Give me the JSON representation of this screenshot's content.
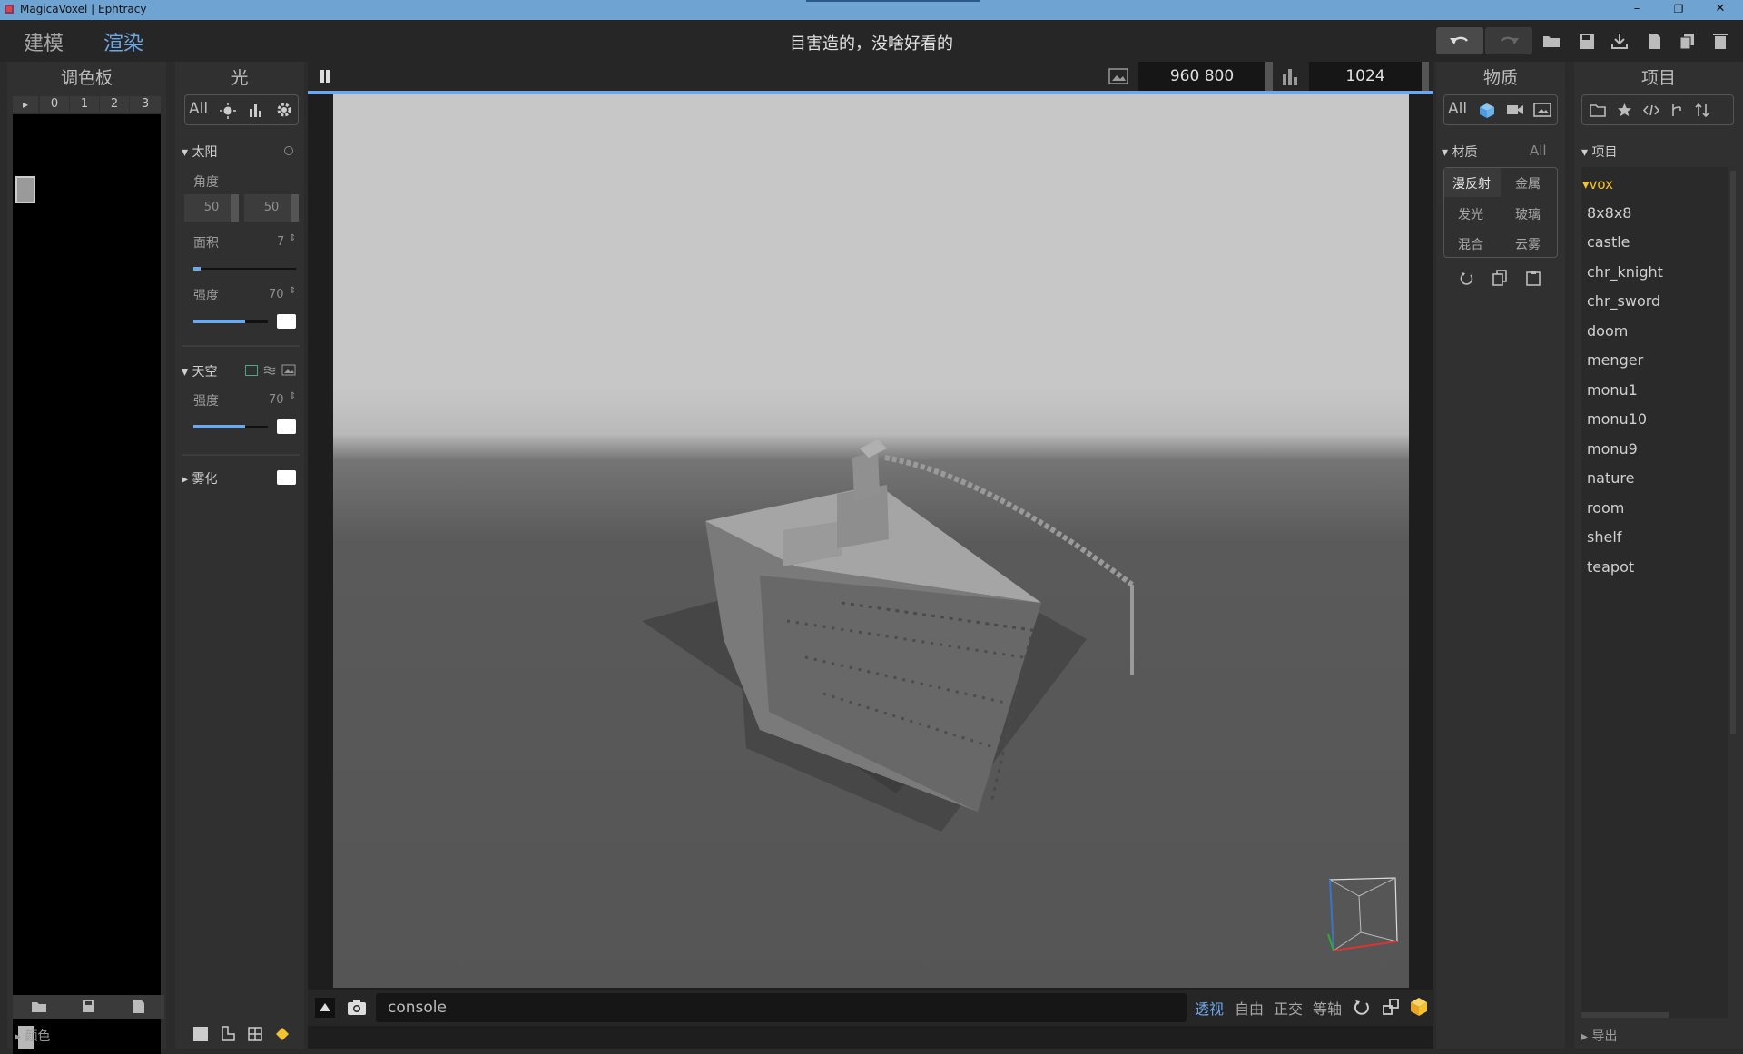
{
  "window": {
    "title": "MagicaVoxel | Ephtracy",
    "minimize": "–",
    "maximize": "❐",
    "close": "✕"
  },
  "modes": {
    "model": "建模",
    "render": "渲染"
  },
  "project_title": "目害造的，没啥好看的",
  "toolbar_icons": [
    "undo-icon",
    "redo-icon",
    "open-icon",
    "save-icon",
    "export-icon",
    "new-icon",
    "copy-icon",
    "delete-icon"
  ],
  "palette": {
    "header": "调色板",
    "tabs": [
      "▸",
      "0",
      "1",
      "2",
      "3"
    ],
    "footer": "颜色"
  },
  "light": {
    "header": "光",
    "filter_all": "All",
    "sun": {
      "title": "太阳",
      "angle_label": "角度",
      "angle1": "50",
      "angle2": "50",
      "area_label": "面积",
      "area_value": "7",
      "intensity_label": "强度",
      "intensity_value": "70"
    },
    "sky": {
      "title": "天空",
      "intensity_label": "强度",
      "intensity_value": "70"
    },
    "fog": {
      "title": "雾化"
    }
  },
  "render": {
    "resolution": "960 800",
    "samples": "1024",
    "console_placeholder": "console",
    "views": [
      "透视",
      "自由",
      "正交",
      "等轴"
    ]
  },
  "material": {
    "header": "物质",
    "filter_all": "All",
    "section": "材质",
    "section_all": "All",
    "types": [
      [
        "漫反射",
        "金属"
      ],
      [
        "发光",
        "玻璃"
      ],
      [
        "混合",
        "云雾"
      ]
    ]
  },
  "project": {
    "header": "项目",
    "section": "项目",
    "folder": "vox",
    "items": [
      "8x8x8",
      "castle",
      "chr_knight",
      "chr_sword",
      "doom",
      "menger",
      "monu1",
      "monu10",
      "monu9",
      "nature",
      "room",
      "shelf",
      "teapot"
    ],
    "export": "导出"
  },
  "colors": {
    "accent": "#6ea8e8",
    "bg": "#2b2b2b",
    "panel": "#303030",
    "titlebar": "#6fa3d2",
    "folder": "#f2c230"
  }
}
